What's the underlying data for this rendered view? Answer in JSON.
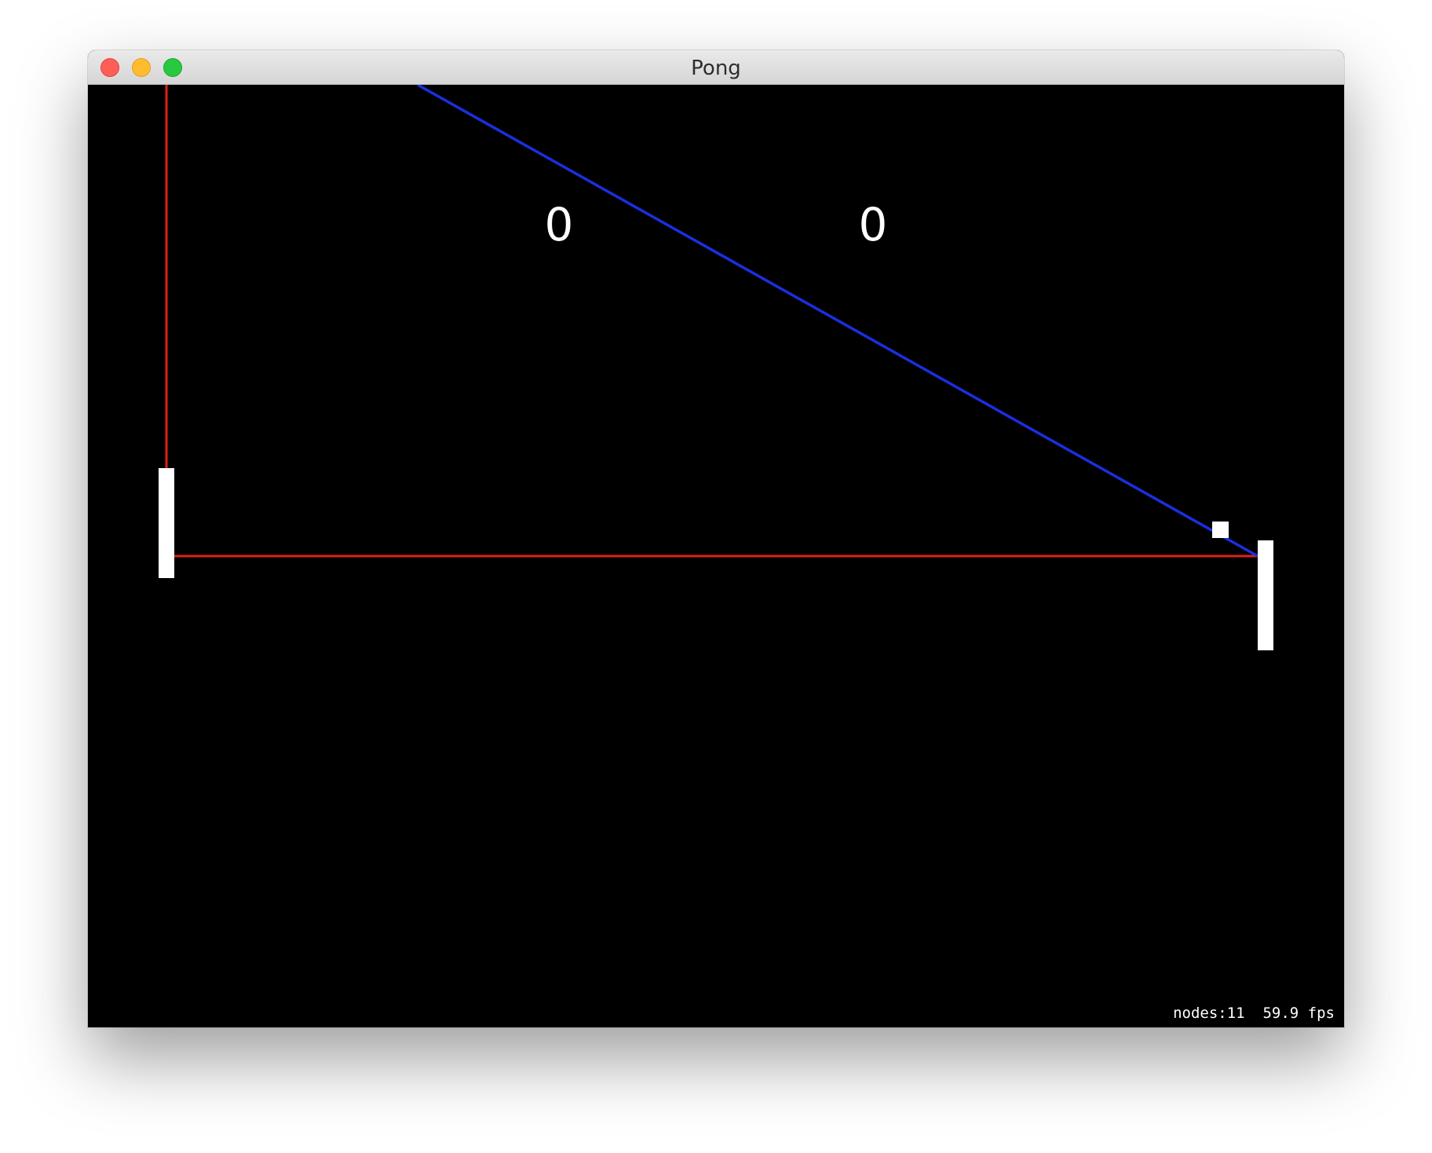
{
  "window": {
    "title": "Pong",
    "controls": [
      "close-icon",
      "minimize-icon",
      "zoom-icon"
    ]
  },
  "game": {
    "score_left": "0",
    "score_right": "0",
    "trajectory_colors": {
      "predicted_path": "#1a2fe0",
      "guide_lines": "#e0201a"
    },
    "background_color": "#000000",
    "foreground_color": "#ffffff"
  },
  "stats": {
    "text": "nodes:11  59.9 fps"
  }
}
